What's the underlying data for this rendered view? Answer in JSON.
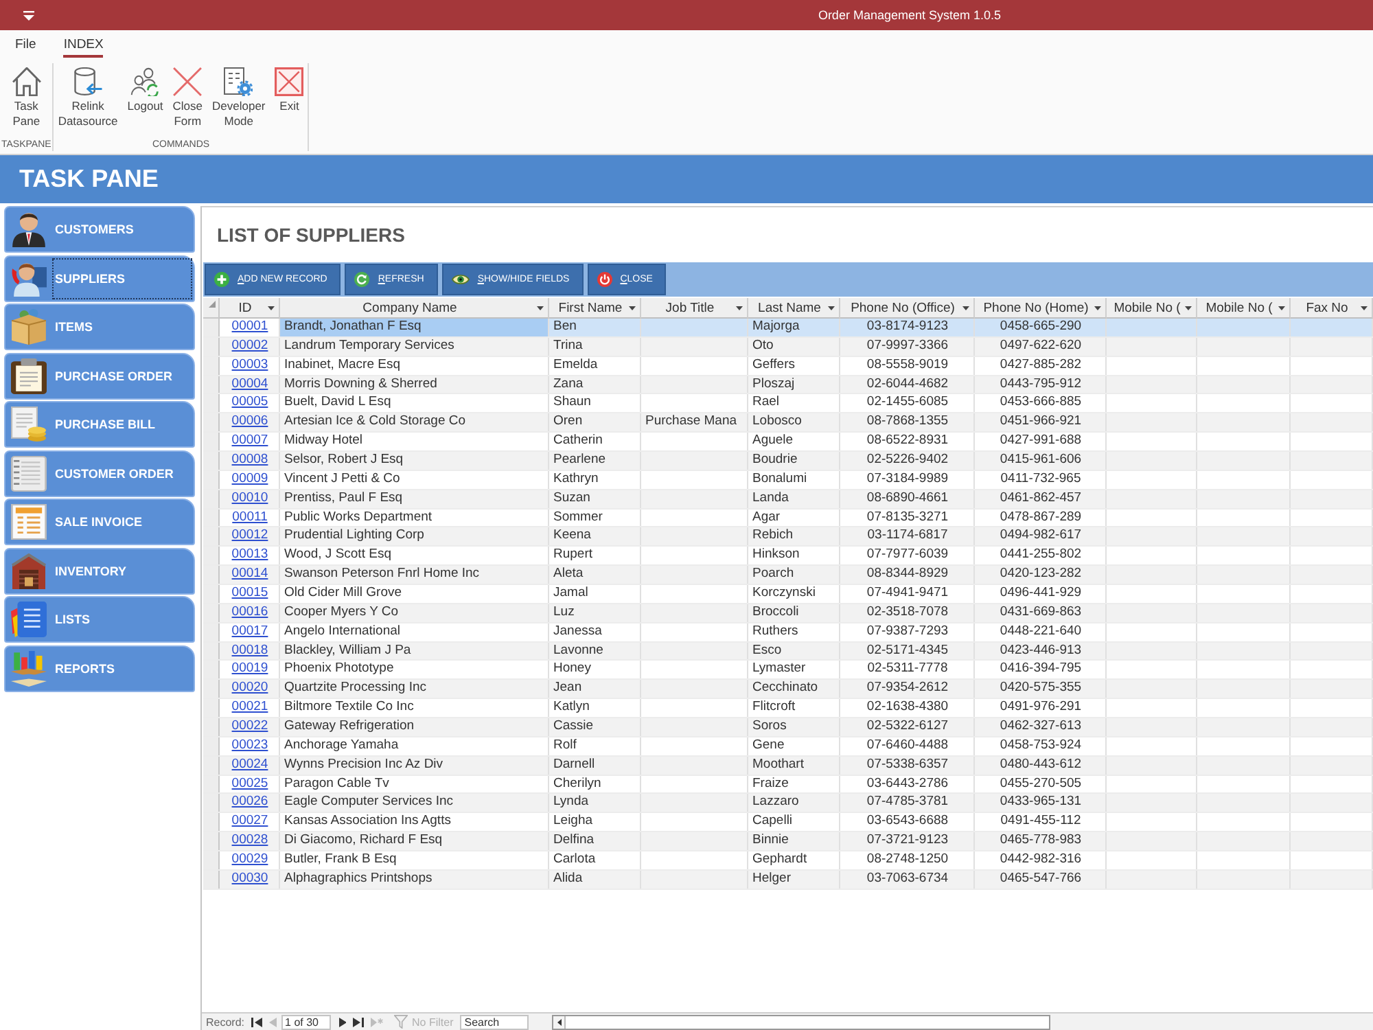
{
  "window": {
    "title": "Order Management System 1.0.5"
  },
  "ribbon": {
    "tabs": [
      {
        "label": "File",
        "selected": false
      },
      {
        "label": "INDEX",
        "selected": true
      }
    ],
    "groups": [
      {
        "label": "TASKPANE",
        "buttons": [
          {
            "label": "Task Pane"
          }
        ]
      },
      {
        "label": "COMMANDS",
        "buttons": [
          {
            "label": "Relink Datasource"
          },
          {
            "label": "Logout"
          },
          {
            "label": "Close Form"
          },
          {
            "label": "Developer Mode"
          },
          {
            "label": "Exit"
          }
        ]
      }
    ]
  },
  "banner": {
    "title": "TASK PANE"
  },
  "sidebar": {
    "items": [
      {
        "label": "CUSTOMERS",
        "selected": false
      },
      {
        "label": "SUPPLIERS",
        "selected": true
      },
      {
        "label": "ITEMS",
        "selected": false
      },
      {
        "label": "PURCHASE ORDER",
        "selected": false
      },
      {
        "label": "PURCHASE BILL",
        "selected": false
      },
      {
        "label": "CUSTOMER ORDER",
        "selected": false
      },
      {
        "label": "SALE INVOICE",
        "selected": false
      },
      {
        "label": "INVENTORY",
        "selected": false
      },
      {
        "label": "LISTS",
        "selected": false
      },
      {
        "label": "REPORTS",
        "selected": false
      }
    ]
  },
  "form": {
    "title": "LIST OF SUPPLIERS",
    "actions": [
      {
        "label": "ADD NEW RECORD"
      },
      {
        "label": "REFRESH"
      },
      {
        "label": "SHOW/HIDE FIELDS"
      },
      {
        "label": "CLOSE"
      }
    ],
    "table": {
      "columns": [
        {
          "label": "ID"
        },
        {
          "label": "Company Name"
        },
        {
          "label": "First Name"
        },
        {
          "label": "Job Title"
        },
        {
          "label": "Last Name"
        },
        {
          "label": "Phone No (Office)"
        },
        {
          "label": "Phone No (Home)"
        },
        {
          "label": "Mobile No ("
        },
        {
          "label": "Mobile No ("
        },
        {
          "label": "Fax No"
        }
      ],
      "rows": [
        {
          "id": "00001",
          "company_name": "Brandt, Jonathan F Esq",
          "first_name": "Ben",
          "last_name": "Majorga",
          "phone_office": "03-8174-9123",
          "phone_home": "0458-665-290",
          "selected": true
        },
        {
          "id": "00002",
          "company_name": "Landrum Temporary Services",
          "first_name": "Trina",
          "last_name": "Oto",
          "phone_office": "07-9997-3366",
          "phone_home": "0497-622-620",
          "selected": false
        },
        {
          "id": "00003",
          "company_name": "Inabinet, Macre Esq",
          "first_name": "Emelda",
          "last_name": "Geffers",
          "phone_office": "08-5558-9019",
          "phone_home": "0427-885-282",
          "selected": false
        },
        {
          "id": "00004",
          "company_name": "Morris Downing & Sherred",
          "first_name": "Zana",
          "last_name": "Ploszaj",
          "phone_office": "02-6044-4682",
          "phone_home": "0443-795-912",
          "selected": false
        },
        {
          "id": "00005",
          "company_name": "Buelt, David L Esq",
          "first_name": "Shaun",
          "last_name": "Rael",
          "phone_office": "02-1455-6085",
          "phone_home": "0453-666-885",
          "selected": false
        },
        {
          "id": "00006",
          "company_name": "Artesian Ice & Cold Storage Co",
          "first_name": "Oren",
          "job_title": "Purchase Mana",
          "last_name": "Lobosco",
          "phone_office": "08-7868-1355",
          "phone_home": "0451-966-921",
          "selected": false
        },
        {
          "id": "00007",
          "company_name": "Midway Hotel",
          "first_name": "Catherin",
          "last_name": "Aguele",
          "phone_office": "08-6522-8931",
          "phone_home": "0427-991-688",
          "selected": false
        },
        {
          "id": "00008",
          "company_name": "Selsor, Robert J Esq",
          "first_name": "Pearlene",
          "last_name": "Boudrie",
          "phone_office": "02-5226-9402",
          "phone_home": "0415-961-606",
          "selected": false
        },
        {
          "id": "00009",
          "company_name": "Vincent J Petti & Co",
          "first_name": "Kathryn",
          "last_name": "Bonalumi",
          "phone_office": "07-3184-9989",
          "phone_home": "0411-732-965",
          "selected": false
        },
        {
          "id": "00010",
          "company_name": "Prentiss, Paul F Esq",
          "first_name": "Suzan",
          "last_name": "Landa",
          "phone_office": "08-6890-4661",
          "phone_home": "0461-862-457",
          "selected": false
        },
        {
          "id": "00011",
          "company_name": "Public Works Department",
          "first_name": "Sommer",
          "last_name": "Agar",
          "phone_office": "07-8135-3271",
          "phone_home": "0478-867-289",
          "selected": false
        },
        {
          "id": "00012",
          "company_name": "Prudential Lighting Corp",
          "first_name": "Keena",
          "last_name": "Rebich",
          "phone_office": "03-1174-6817",
          "phone_home": "0494-982-617",
          "selected": false
        },
        {
          "id": "00013",
          "company_name": "Wood, J Scott Esq",
          "first_name": "Rupert",
          "last_name": "Hinkson",
          "phone_office": "07-7977-6039",
          "phone_home": "0441-255-802",
          "selected": false
        },
        {
          "id": "00014",
          "company_name": "Swanson Peterson Fnrl Home Inc",
          "first_name": "Aleta",
          "last_name": "Poarch",
          "phone_office": "08-8344-8929",
          "phone_home": "0420-123-282",
          "selected": false
        },
        {
          "id": "00015",
          "company_name": "Old Cider Mill Grove",
          "first_name": "Jamal",
          "last_name": "Korczynski",
          "phone_office": "07-4941-9471",
          "phone_home": "0496-441-929",
          "selected": false
        },
        {
          "id": "00016",
          "company_name": "Cooper Myers Y Co",
          "first_name": "Luz",
          "last_name": "Broccoli",
          "phone_office": "02-3518-7078",
          "phone_home": "0431-669-863",
          "selected": false
        },
        {
          "id": "00017",
          "company_name": "Angelo International",
          "first_name": "Janessa",
          "last_name": "Ruthers",
          "phone_office": "07-9387-7293",
          "phone_home": "0448-221-640",
          "selected": false
        },
        {
          "id": "00018",
          "company_name": "Blackley, William J Pa",
          "first_name": "Lavonne",
          "last_name": "Esco",
          "phone_office": "02-5171-4345",
          "phone_home": "0423-446-913",
          "selected": false
        },
        {
          "id": "00019",
          "company_name": "Phoenix Phototype",
          "first_name": "Honey",
          "last_name": "Lymaster",
          "phone_office": "02-5311-7778",
          "phone_home": "0416-394-795",
          "selected": false
        },
        {
          "id": "00020",
          "company_name": "Quartzite Processing Inc",
          "first_name": "Jean",
          "last_name": "Cecchinato",
          "phone_office": "07-9354-2612",
          "phone_home": "0420-575-355",
          "selected": false
        },
        {
          "id": "00021",
          "company_name": "Biltmore Textile Co Inc",
          "first_name": "Katlyn",
          "last_name": "Flitcroft",
          "phone_office": "02-1638-4380",
          "phone_home": "0491-976-291",
          "selected": false
        },
        {
          "id": "00022",
          "company_name": "Gateway Refrigeration",
          "first_name": "Cassie",
          "last_name": "Soros",
          "phone_office": "02-5322-6127",
          "phone_home": "0462-327-613",
          "selected": false
        },
        {
          "id": "00023",
          "company_name": "Anchorage Yamaha",
          "first_name": "Rolf",
          "last_name": "Gene",
          "phone_office": "07-6460-4488",
          "phone_home": "0458-753-924",
          "selected": false
        },
        {
          "id": "00024",
          "company_name": "Wynns Precision Inc Az Div",
          "first_name": "Darnell",
          "last_name": "Moothart",
          "phone_office": "07-5338-6357",
          "phone_home": "0480-443-612",
          "selected": false
        },
        {
          "id": "00025",
          "company_name": "Paragon Cable Tv",
          "first_name": "Cherilyn",
          "last_name": "Fraize",
          "phone_office": "03-6443-2786",
          "phone_home": "0455-270-505",
          "selected": false
        },
        {
          "id": "00026",
          "company_name": "Eagle Computer Services Inc",
          "first_name": "Lynda",
          "last_name": "Lazzaro",
          "phone_office": "07-4785-3781",
          "phone_home": "0433-965-131",
          "selected": false
        },
        {
          "id": "00027",
          "company_name": "Kansas Association Ins Agtts",
          "first_name": "Leigha",
          "last_name": "Capelli",
          "phone_office": "03-6543-6688",
          "phone_home": "0491-455-112",
          "selected": false
        },
        {
          "id": "00028",
          "company_name": "Di Giacomo, Richard F Esq",
          "first_name": "Delfina",
          "last_name": "Binnie",
          "phone_office": "07-3721-9123",
          "phone_home": "0465-778-983",
          "selected": false
        },
        {
          "id": "00029",
          "company_name": "Butler, Frank B Esq",
          "first_name": "Carlota",
          "last_name": "Gephardt",
          "phone_office": "08-2748-1250",
          "phone_home": "0442-982-316",
          "selected": false
        },
        {
          "id": "00030",
          "company_name": "Alphagraphics Printshops",
          "first_name": "Alida",
          "last_name": "Helger",
          "phone_office": "03-7063-6734",
          "phone_home": "0465-547-766",
          "selected": false
        }
      ]
    }
  },
  "status_bar": {
    "label": "Record:",
    "nav": [
      {
        "disabled": false
      },
      {
        "disabled": true
      },
      {
        "disabled": false
      },
      {
        "disabled": false
      },
      {
        "disabled": true
      }
    ],
    "position": "1 of 30",
    "filter": {
      "label": "No Filter",
      "disabled": true
    },
    "search": {
      "placeholder": "Search"
    }
  }
}
